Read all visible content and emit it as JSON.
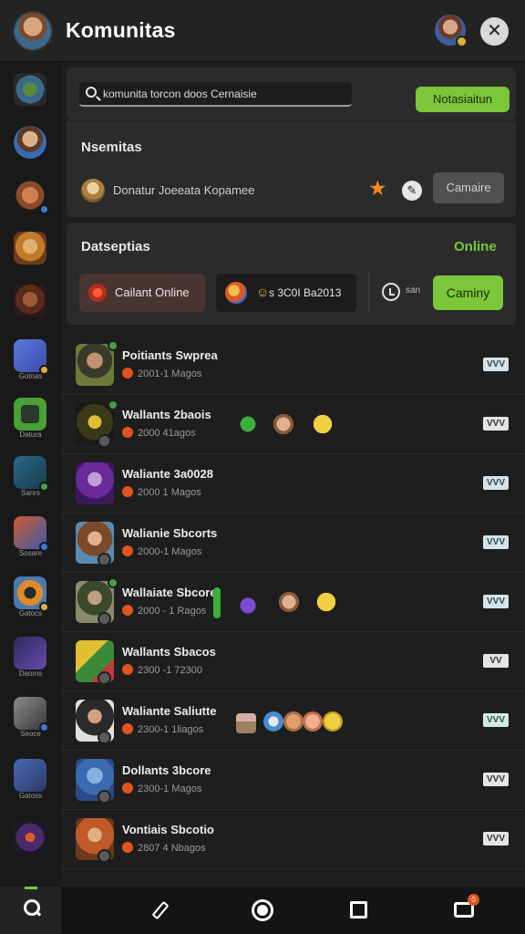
{
  "header": {
    "title": "Komunitas",
    "close_icon": "close-icon"
  },
  "sidebar": {
    "labels": [
      "Gotoas",
      "Datura",
      "Sanrs",
      "Sosare",
      "Gatocs",
      "Daoms",
      "Seoce",
      "Gatoss"
    ]
  },
  "search": {
    "value": "komunita torcon doos Cernaisie",
    "notif_label": "Notasiaitun"
  },
  "panel2": {
    "title": "Nsemitas",
    "user_text": "Donatur Joeeata Kopamee",
    "button_label": "Camaire"
  },
  "panel3": {
    "title": "Datseptias",
    "online_label": "Online",
    "chip1_label": "Cailant Online",
    "chip2_label": "s 3C0I Ba2013",
    "small_text": "san",
    "button_label": "Caminy"
  },
  "rows": [
    {
      "name": "Poitiants Swprea",
      "meta": "2001-1 Magos",
      "tag": "VVV"
    },
    {
      "name": "Wallants 2baois",
      "meta": "2000 41agos",
      "tag": "VVV"
    },
    {
      "name": "Waliante 3a0028",
      "meta": "2000 1 Magos",
      "tag": "VVV"
    },
    {
      "name": "Walianie Sbcorts",
      "meta": "2000-1 Magos",
      "tag": "VVV"
    },
    {
      "name": "Wallaiate Sbcore",
      "meta": "2000 - 1 Ragos",
      "tag": "VVV"
    },
    {
      "name": "Wallants Sbacos",
      "meta": "2300 -1 72300",
      "tag": "VV"
    },
    {
      "name": "Waliante Saliutte",
      "meta": "2300-1 1liagos",
      "tag": "VVV"
    },
    {
      "name": "Dollants 3bcore",
      "meta": "2300-1 Magos",
      "tag": "VVV"
    },
    {
      "name": "Vontiais Sbcotio",
      "meta": "2807 4 Nbagos",
      "tag": "VVV"
    }
  ],
  "nav": {
    "badge_count": "0"
  },
  "colors": {
    "accent": "#7bc639",
    "star": "#f08a1e",
    "badge": "#e0541e"
  }
}
